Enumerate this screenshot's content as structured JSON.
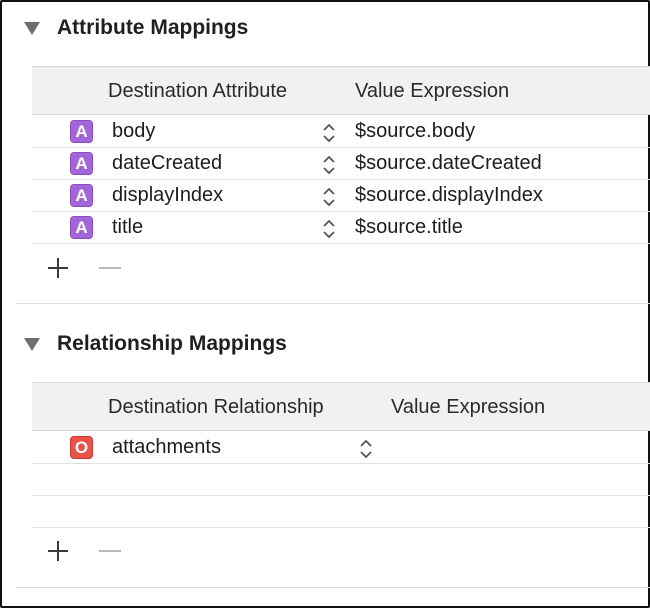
{
  "attribute_section": {
    "title": "Attribute Mappings",
    "col_destination": "Destination Attribute",
    "col_value": "Value Expression",
    "rows": [
      {
        "badge": "A",
        "name": "body",
        "expr": "$source.body"
      },
      {
        "badge": "A",
        "name": "dateCreated",
        "expr": "$source.dateCreated"
      },
      {
        "badge": "A",
        "name": "displayIndex",
        "expr": "$source.displayIndex"
      },
      {
        "badge": "A",
        "name": "title",
        "expr": "$source.title"
      }
    ]
  },
  "relationship_section": {
    "title": "Relationship Mappings",
    "col_destination": "Destination Relationship",
    "col_value": "Value Expression",
    "rows": [
      {
        "badge": "O",
        "name": "attachments",
        "expr": ""
      }
    ]
  },
  "icons": {
    "disclosure": "disclosure-triangle-icon",
    "add": "plus-icon",
    "remove": "minus-icon",
    "stepper": "up-down-chevron-icon"
  },
  "colors": {
    "attribute_badge": "#a466d6",
    "relationship_badge": "#e8534a",
    "header_bg": "#f1f1f1"
  }
}
